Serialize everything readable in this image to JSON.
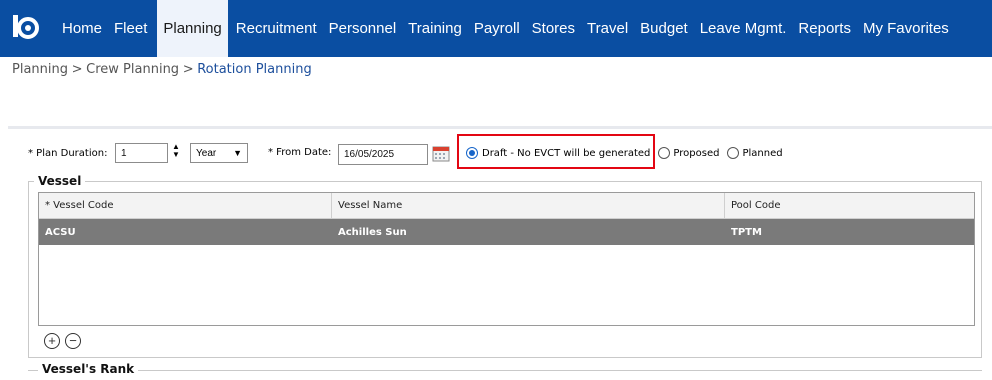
{
  "nav": {
    "items": [
      {
        "label": "Home",
        "active": false
      },
      {
        "label": "Fleet",
        "active": false
      },
      {
        "label": "Planning",
        "active": true
      },
      {
        "label": "Recruitment",
        "active": false
      },
      {
        "label": "Personnel",
        "active": false
      },
      {
        "label": "Training",
        "active": false
      },
      {
        "label": "Payroll",
        "active": false
      },
      {
        "label": "Stores",
        "active": false
      },
      {
        "label": "Travel",
        "active": false
      },
      {
        "label": "Budget",
        "active": false
      },
      {
        "label": "Leave Mgmt.",
        "active": false
      },
      {
        "label": "Reports",
        "active": false
      },
      {
        "label": "My Favorites",
        "active": false
      }
    ],
    "logo_icon": "app-logo-icon",
    "bar_color": "#0a4ea2"
  },
  "breadcrumb": {
    "parts": [
      "Planning",
      "Crew Planning",
      "Rotation Planning"
    ],
    "separator": ">"
  },
  "form": {
    "plan_duration_label": "* Plan Duration:",
    "plan_duration_value": "1",
    "duration_unit": "Year",
    "from_date_label": "* From Date:",
    "from_date_value": "16/05/2025",
    "radios": [
      {
        "label": "Draft - No EVCT will be generated",
        "checked": true
      },
      {
        "label": "Proposed",
        "checked": false
      },
      {
        "label": "Planned",
        "checked": false
      }
    ]
  },
  "vessel": {
    "legend": "Vessel",
    "columns": [
      "* Vessel Code",
      "Vessel Name",
      "Pool Code"
    ],
    "rows": [
      {
        "code": "ACSU",
        "name": "Achilles Sun",
        "pool": "TPTM"
      }
    ]
  },
  "vessel_rank": {
    "legend": "Vessel's Rank"
  },
  "highlight_color": "#e30613",
  "selected_row_color": "#7a7a7a"
}
